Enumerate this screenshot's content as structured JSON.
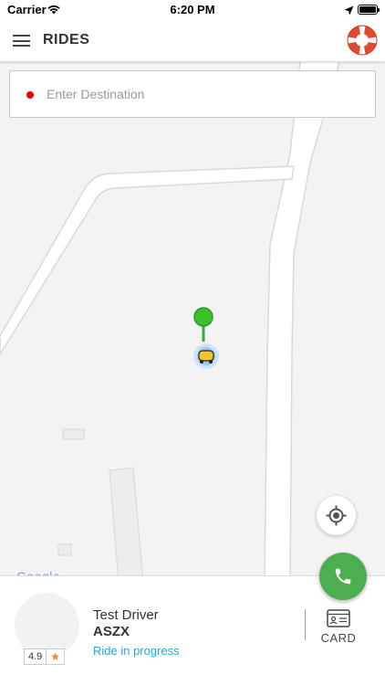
{
  "status_bar": {
    "carrier": "Carrier",
    "time": "6:20 PM"
  },
  "header": {
    "title": "RIDES",
    "menu_icon": "hamburger-menu-icon",
    "help_icon": "lifebuoy-icon"
  },
  "destination": {
    "placeholder": "Enter Destination",
    "value": ""
  },
  "map": {
    "attribution": "Google"
  },
  "driver": {
    "name": "Test Driver",
    "plate": "ASZX",
    "status": "Ride in progress",
    "rating": "4.9",
    "rating_icon": "star-icon"
  },
  "actions": {
    "card_label": "CARD",
    "call_icon": "phone-icon",
    "locate_icon": "crosshair-icon"
  },
  "colors": {
    "accent_green": "#4cae4f",
    "status_blue": "#1fa9d6",
    "destination_dot": "#e00000",
    "help_red": "#e04a2f"
  }
}
